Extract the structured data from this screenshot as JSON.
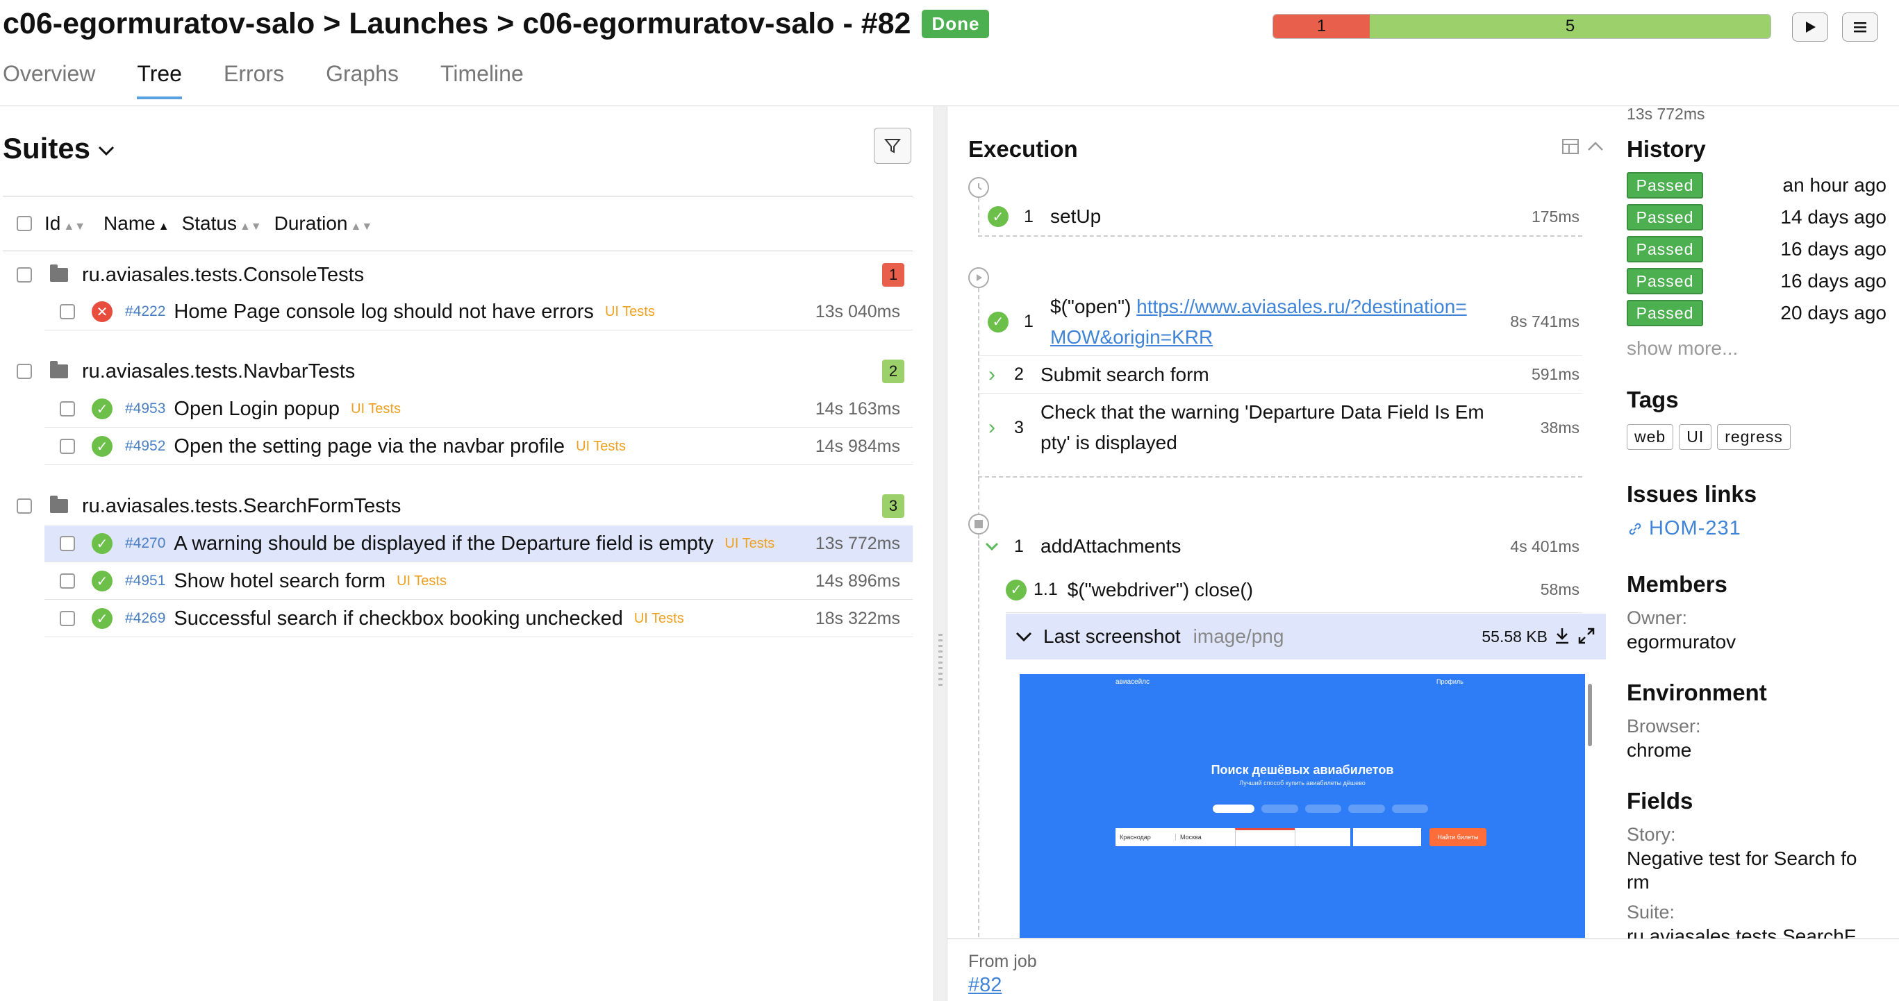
{
  "header": {
    "project": "c06-egormuratov-salo",
    "launches": "Launches",
    "launch_name": "c06-egormuratov-salo - #82",
    "status_badge": "Done",
    "failed_count": "1",
    "passed_count": "5",
    "failed_fraction": 0.1944,
    "passed_fraction": 0.8056
  },
  "tabs": [
    {
      "label": "Overview"
    },
    {
      "label": "Tree"
    },
    {
      "label": "Errors"
    },
    {
      "label": "Graphs"
    },
    {
      "label": "Timeline"
    }
  ],
  "tree": {
    "title": "Suites",
    "columns": {
      "id": "Id",
      "name": "Name",
      "status": "Status",
      "duration": "Duration"
    },
    "groups": [
      {
        "name": "ru.aviasales.tests.ConsoleTests",
        "count": "1",
        "tests": [
          {
            "id": "#4222",
            "name": "Home Page console log should not have errors",
            "label": "UI Tests",
            "duration": "13s 040ms",
            "status": "failed"
          }
        ]
      },
      {
        "name": "ru.aviasales.tests.NavbarTests",
        "count": "2",
        "tests": [
          {
            "id": "#4953",
            "name": "Open Login popup",
            "label": "UI Tests",
            "duration": "14s 163ms",
            "status": "passed"
          },
          {
            "id": "#4952",
            "name": "Open the setting page via the navbar profile",
            "label": "UI Tests",
            "duration": "14s 984ms",
            "status": "passed"
          }
        ]
      },
      {
        "name": "ru.aviasales.tests.SearchFormTests",
        "count": "3",
        "tests": [
          {
            "id": "#4270",
            "name": "A warning should be displayed if the Departure field is empty",
            "label": "UI Tests",
            "duration": "13s 772ms",
            "status": "passed"
          },
          {
            "id": "#4951",
            "name": "Show hotel search form",
            "label": "UI Tests",
            "duration": "14s 896ms",
            "status": "passed"
          },
          {
            "id": "#4269",
            "name": "Successful search if checkbox booking unchecked",
            "label": "UI Tests",
            "duration": "18s 322ms",
            "status": "passed"
          }
        ]
      }
    ]
  },
  "execution": {
    "title": "Execution",
    "top_duration": "13s 772ms",
    "setup": {
      "num": "1",
      "name": "setUp",
      "duration": "175ms"
    },
    "body": [
      {
        "num": "1",
        "prefix": "$(\"open\") ",
        "link": "https://www.aviasales.ru/?destination=",
        "link2": "MOW&origin=KRR",
        "duration": "8s 741ms"
      },
      {
        "num": "2",
        "name": "Submit search form",
        "duration": "591ms"
      },
      {
        "num": "3",
        "name": "Check that the warning 'Departure Data Field Is Em",
        "name2": "pty' is displayed",
        "duration": "38ms"
      }
    ],
    "teardown": {
      "num": "1",
      "name": "addAttachments",
      "duration": "4s 401ms",
      "sub": {
        "num": "1.1",
        "name": "$(\"webdriver\") close()",
        "duration": "58ms"
      },
      "attachment": {
        "name": "Last screenshot",
        "type": "image/png",
        "size": "55.58 KB"
      }
    },
    "screenshot": {
      "logo": "авиасейлс",
      "headline": "Поиск дешёвых авиабилетов",
      "sub": "Лучший способ купить авиабилеты дёшево",
      "from": "Краснодар",
      "to": "Москва",
      "button": "Найти билеты",
      "user": "Профиль"
    }
  },
  "right": {
    "history_title": "History",
    "history": [
      {
        "status": "Passed",
        "time": "an hour ago"
      },
      {
        "status": "Passed",
        "time": "14 days ago"
      },
      {
        "status": "Passed",
        "time": "16 days ago"
      },
      {
        "status": "Passed",
        "time": "16 days ago"
      },
      {
        "status": "Passed",
        "time": "20 days ago"
      }
    ],
    "show_more": "show more...",
    "tags_title": "Tags",
    "tags": [
      "web",
      "UI",
      "regress"
    ],
    "issues_title": "Issues links",
    "issue": "HOM-231",
    "members_title": "Members",
    "owner_label": "Owner:",
    "owner": "egormuratov",
    "env_title": "Environment",
    "browser_label": "Browser:",
    "browser": "chrome",
    "fields_title": "Fields",
    "story_label": "Story:",
    "story_1": "Negative test for Search fo",
    "story_2": "rm",
    "suite_label": "Suite:",
    "suite": "ru.aviasales.tests.SearchF"
  },
  "footer": {
    "label": "From job",
    "job": "#82"
  },
  "colors": {
    "failed": "#e8604c",
    "passed": "#9cd06a",
    "badge": "#4caf50",
    "link": "#3f84d6",
    "selected": "#dfe6fb"
  }
}
